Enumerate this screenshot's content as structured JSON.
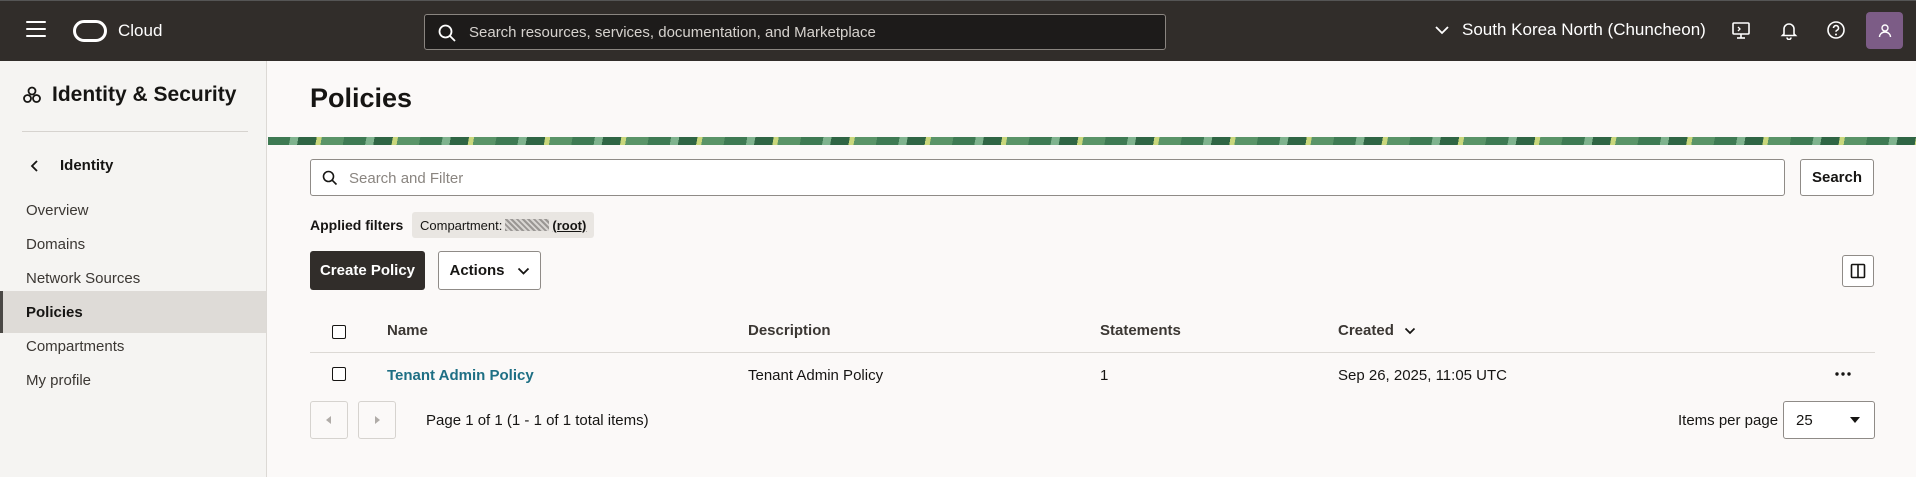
{
  "topbar": {
    "brand": "Cloud",
    "search_placeholder": "Search resources, services, documentation, and Marketplace",
    "region": "South Korea North (Chuncheon)"
  },
  "sidebar": {
    "title": "Identity & Security",
    "back_label": "Identity",
    "items": [
      {
        "label": "Overview"
      },
      {
        "label": "Domains"
      },
      {
        "label": "Network Sources"
      },
      {
        "label": "Policies"
      },
      {
        "label": "Compartments"
      },
      {
        "label": "My profile"
      }
    ],
    "active": "Policies"
  },
  "main": {
    "title": "Policies",
    "filter_placeholder": "Search and Filter",
    "search_button": "Search",
    "applied_filters_label": "Applied filters",
    "chip_label": "Compartment:",
    "chip_value": "(root)",
    "create_button": "Create Policy",
    "actions_button": "Actions",
    "table": {
      "columns": [
        "Name",
        "Description",
        "Statements",
        "Created"
      ],
      "rows": [
        {
          "name": "Tenant Admin Policy",
          "description": "Tenant Admin Policy",
          "statements": "1",
          "created": "Sep 26, 2025, 11:05 UTC"
        }
      ]
    },
    "pagination": {
      "text": "Page 1 of 1 (1 - 1 of 1 total items)",
      "items_per_page_label": "Items per page",
      "items_per_page_value": "25"
    }
  },
  "colors": {
    "topbar_bg": "#312d2a",
    "link": "#1e6f84",
    "primary_button": "#312d2a",
    "avatar": "#7c5c86"
  }
}
